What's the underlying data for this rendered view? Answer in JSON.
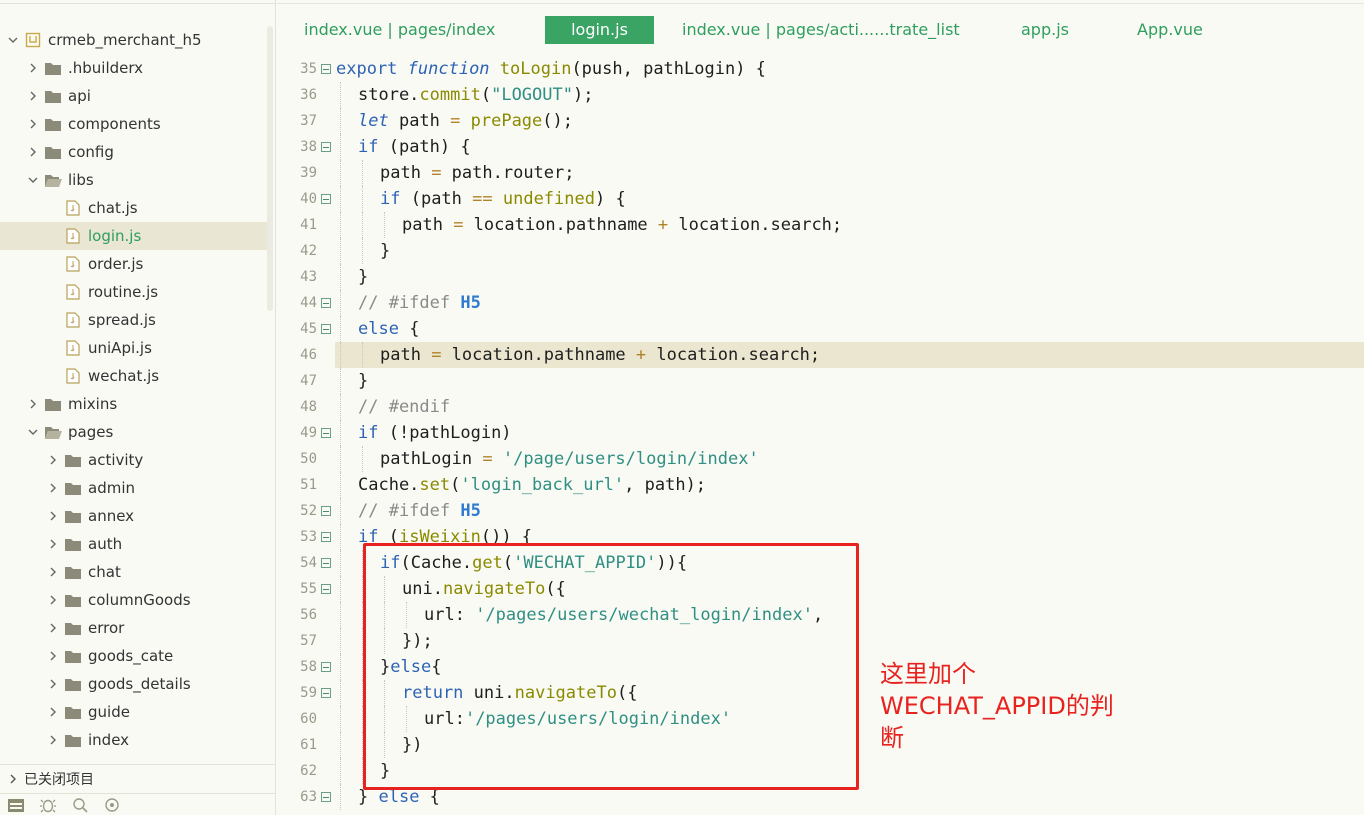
{
  "sidebar": {
    "tree": [
      {
        "label": "crmeb_merchant_h5",
        "indent": 0,
        "arrow": "down",
        "icon": "project"
      },
      {
        "label": ".hbuilderx",
        "indent": 1,
        "arrow": "right",
        "icon": "folder"
      },
      {
        "label": "api",
        "indent": 1,
        "arrow": "right",
        "icon": "folder"
      },
      {
        "label": "components",
        "indent": 1,
        "arrow": "right",
        "icon": "folder"
      },
      {
        "label": "config",
        "indent": 1,
        "arrow": "right",
        "icon": "folder"
      },
      {
        "label": "libs",
        "indent": 1,
        "arrow": "down",
        "icon": "folder-open"
      },
      {
        "label": "chat.js",
        "indent": 2,
        "arrow": "none",
        "icon": "file"
      },
      {
        "label": "login.js",
        "indent": 2,
        "arrow": "none",
        "icon": "file",
        "selected": true
      },
      {
        "label": "order.js",
        "indent": 2,
        "arrow": "none",
        "icon": "file"
      },
      {
        "label": "routine.js",
        "indent": 2,
        "arrow": "none",
        "icon": "file"
      },
      {
        "label": "spread.js",
        "indent": 2,
        "arrow": "none",
        "icon": "file"
      },
      {
        "label": "uniApi.js",
        "indent": 2,
        "arrow": "none",
        "icon": "file"
      },
      {
        "label": "wechat.js",
        "indent": 2,
        "arrow": "none",
        "icon": "file"
      },
      {
        "label": "mixins",
        "indent": 1,
        "arrow": "right",
        "icon": "folder"
      },
      {
        "label": "pages",
        "indent": 1,
        "arrow": "down",
        "icon": "folder-open"
      },
      {
        "label": "activity",
        "indent": 2,
        "arrow": "right",
        "icon": "folder"
      },
      {
        "label": "admin",
        "indent": 2,
        "arrow": "right",
        "icon": "folder"
      },
      {
        "label": "annex",
        "indent": 2,
        "arrow": "right",
        "icon": "folder"
      },
      {
        "label": "auth",
        "indent": 2,
        "arrow": "right",
        "icon": "folder"
      },
      {
        "label": "chat",
        "indent": 2,
        "arrow": "right",
        "icon": "folder"
      },
      {
        "label": "columnGoods",
        "indent": 2,
        "arrow": "right",
        "icon": "folder"
      },
      {
        "label": "error",
        "indent": 2,
        "arrow": "right",
        "icon": "folder"
      },
      {
        "label": "goods_cate",
        "indent": 2,
        "arrow": "right",
        "icon": "folder"
      },
      {
        "label": "goods_details",
        "indent": 2,
        "arrow": "right",
        "icon": "folder"
      },
      {
        "label": "guide",
        "indent": 2,
        "arrow": "right",
        "icon": "folder"
      },
      {
        "label": "index",
        "indent": 2,
        "arrow": "right",
        "icon": "folder"
      }
    ],
    "closed_projects_label": "已关闭项目"
  },
  "tabs": [
    {
      "label": "index.vue | pages/index",
      "active": false
    },
    {
      "label": "login.js",
      "active": true
    },
    {
      "label": "index.vue | pages/acti......trate_list",
      "active": false
    },
    {
      "label": "app.js",
      "active": false
    },
    {
      "label": "App.vue",
      "active": false
    }
  ],
  "editor": {
    "highlighted_line": 46,
    "lines": [
      {
        "n": 35,
        "fold": true,
        "indent": 0,
        "tokens": [
          [
            "k",
            "export "
          ],
          [
            "ki",
            "function "
          ],
          [
            "f",
            "toLogin"
          ],
          [
            "",
            "(push, pathLogin) {"
          ]
        ]
      },
      {
        "n": 36,
        "fold": false,
        "indent": 1,
        "tokens": [
          [
            "",
            "store."
          ],
          [
            "f",
            "commit"
          ],
          [
            "",
            "("
          ],
          [
            "s",
            "\"LOGOUT\""
          ],
          [
            "",
            ");"
          ]
        ]
      },
      {
        "n": 37,
        "fold": false,
        "indent": 1,
        "tokens": [
          [
            "ki",
            "let "
          ],
          [
            "",
            "path "
          ],
          [
            "o",
            "= "
          ],
          [
            "f",
            "prePage"
          ],
          [
            "",
            "();"
          ]
        ]
      },
      {
        "n": 38,
        "fold": true,
        "indent": 1,
        "tokens": [
          [
            "k",
            "if "
          ],
          [
            "",
            "(path) {"
          ]
        ]
      },
      {
        "n": 39,
        "fold": false,
        "indent": 2,
        "tokens": [
          [
            "",
            "path "
          ],
          [
            "o",
            "= "
          ],
          [
            "",
            "path.router;"
          ]
        ]
      },
      {
        "n": 40,
        "fold": true,
        "indent": 2,
        "tokens": [
          [
            "k",
            "if "
          ],
          [
            "",
            "(path "
          ],
          [
            "o",
            "== "
          ],
          [
            "f",
            "undefined"
          ],
          [
            "",
            ") {"
          ]
        ]
      },
      {
        "n": 41,
        "fold": false,
        "indent": 3,
        "tokens": [
          [
            "",
            "path "
          ],
          [
            "o",
            "= "
          ],
          [
            "",
            "location.pathname "
          ],
          [
            "o",
            "+ "
          ],
          [
            "",
            "location.search;"
          ]
        ]
      },
      {
        "n": 42,
        "fold": false,
        "indent": 2,
        "tokens": [
          [
            "",
            "}"
          ]
        ]
      },
      {
        "n": 43,
        "fold": false,
        "indent": 1,
        "tokens": [
          [
            "",
            "}"
          ]
        ]
      },
      {
        "n": 44,
        "fold": true,
        "indent": 1,
        "tokens": [
          [
            "c",
            "// #ifdef "
          ],
          [
            "cb",
            "H5"
          ]
        ]
      },
      {
        "n": 45,
        "fold": true,
        "indent": 1,
        "tokens": [
          [
            "k",
            "else "
          ],
          [
            "",
            "{"
          ]
        ]
      },
      {
        "n": 46,
        "fold": false,
        "indent": 2,
        "tokens": [
          [
            "",
            "path "
          ],
          [
            "o",
            "= "
          ],
          [
            "",
            "location.pathname "
          ],
          [
            "o",
            "+ "
          ],
          [
            "",
            "location.search;"
          ]
        ]
      },
      {
        "n": 47,
        "fold": false,
        "indent": 1,
        "tokens": [
          [
            "",
            "}"
          ]
        ]
      },
      {
        "n": 48,
        "fold": false,
        "indent": 1,
        "tokens": [
          [
            "c",
            "// #endif"
          ]
        ]
      },
      {
        "n": 49,
        "fold": true,
        "indent": 1,
        "tokens": [
          [
            "k",
            "if "
          ],
          [
            "",
            "(!pathLogin)"
          ]
        ]
      },
      {
        "n": 50,
        "fold": false,
        "indent": 2,
        "tokens": [
          [
            "",
            "pathLogin "
          ],
          [
            "o",
            "= "
          ],
          [
            "s",
            "'/page/users/login/index'"
          ]
        ]
      },
      {
        "n": 51,
        "fold": false,
        "indent": 1,
        "tokens": [
          [
            "",
            "Cache."
          ],
          [
            "f",
            "set"
          ],
          [
            "",
            "("
          ],
          [
            "s",
            "'login_back_url'"
          ],
          [
            "",
            ", path);"
          ]
        ]
      },
      {
        "n": 52,
        "fold": true,
        "indent": 1,
        "tokens": [
          [
            "c",
            "// #ifdef "
          ],
          [
            "cb",
            "H5"
          ]
        ]
      },
      {
        "n": 53,
        "fold": true,
        "indent": 1,
        "tokens": [
          [
            "k",
            "if "
          ],
          [
            "",
            "("
          ],
          [
            "f",
            "isWeixin"
          ],
          [
            "",
            "()) {"
          ]
        ]
      },
      {
        "n": 54,
        "fold": true,
        "indent": 2,
        "tokens": [
          [
            "k",
            "if"
          ],
          [
            "",
            "(Cache."
          ],
          [
            "f",
            "get"
          ],
          [
            "",
            "("
          ],
          [
            "s",
            "'WECHAT_APPID'"
          ],
          [
            "",
            "))"
          ],
          [
            "",
            "{"
          ]
        ]
      },
      {
        "n": 55,
        "fold": true,
        "indent": 3,
        "tokens": [
          [
            "",
            "uni."
          ],
          [
            "f",
            "navigateTo"
          ],
          [
            "",
            "({"
          ]
        ]
      },
      {
        "n": 56,
        "fold": false,
        "indent": 4,
        "tokens": [
          [
            "",
            "url: "
          ],
          [
            "s",
            "'/pages/users/wechat_login/index'"
          ],
          [
            "",
            ","
          ]
        ]
      },
      {
        "n": 57,
        "fold": false,
        "indent": 3,
        "tokens": [
          [
            "",
            "});"
          ]
        ]
      },
      {
        "n": 58,
        "fold": true,
        "indent": 2,
        "tokens": [
          [
            "",
            "}"
          ],
          [
            "k",
            "else"
          ],
          [
            "",
            "{"
          ]
        ]
      },
      {
        "n": 59,
        "fold": true,
        "indent": 3,
        "tokens": [
          [
            "k",
            "return "
          ],
          [
            "",
            "uni."
          ],
          [
            "f",
            "navigateTo"
          ],
          [
            "",
            "({"
          ]
        ]
      },
      {
        "n": 60,
        "fold": false,
        "indent": 4,
        "tokens": [
          [
            "",
            "url:"
          ],
          [
            "s",
            "'/pages/users/login/index'"
          ]
        ]
      },
      {
        "n": 61,
        "fold": false,
        "indent": 3,
        "tokens": [
          [
            "",
            "})"
          ]
        ]
      },
      {
        "n": 62,
        "fold": false,
        "indent": 2,
        "tokens": [
          [
            "",
            "}"
          ]
        ]
      },
      {
        "n": 63,
        "fold": true,
        "indent": 1,
        "tokens": [
          [
            "",
            "} "
          ],
          [
            "k",
            "else "
          ],
          [
            "",
            "{"
          ]
        ]
      }
    ]
  },
  "annotation": {
    "lines": [
      "这里加个",
      "WECHAT_APPID的判",
      "断"
    ]
  },
  "colors": {
    "accent_green": "#3aa465",
    "annotation_red": "#e8231f",
    "highlight_line": "#ebe6cf"
  }
}
